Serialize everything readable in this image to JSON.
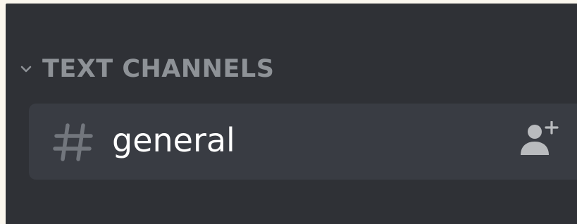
{
  "sidebar": {
    "category": {
      "label": "TEXT CHANNELS",
      "icon": "chevron-down-icon"
    },
    "channels": [
      {
        "name": "general",
        "icon": "hashtag-icon",
        "action_icon": "add-user-icon",
        "selected": true
      }
    ]
  },
  "colors": {
    "panel_background": "#2f3136",
    "selected_channel_background": "#393c43",
    "category_text": "#8e9297",
    "channel_text": "#ffffff",
    "icon_muted": "#72767d",
    "icon_action": "#b9bbbe"
  }
}
